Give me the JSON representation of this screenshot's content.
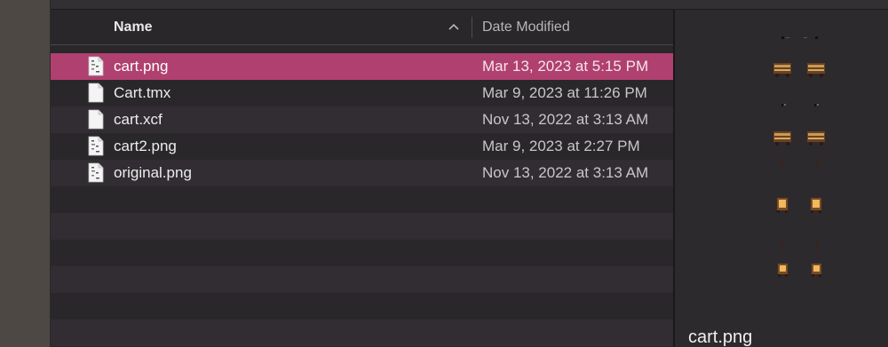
{
  "columns": {
    "name": "Name",
    "date_modified": "Date Modified"
  },
  "files": [
    {
      "name": "cart.png",
      "date": "Mar 13, 2023 at 5:15 PM",
      "icon": "image-file-icon",
      "selected": true
    },
    {
      "name": "Cart.tmx",
      "date": "Mar 9, 2023 at 11:26 PM",
      "icon": "document-file-icon",
      "selected": false
    },
    {
      "name": "cart.xcf",
      "date": "Nov 13, 2022 at 3:13 AM",
      "icon": "document-file-icon",
      "selected": false
    },
    {
      "name": "cart2.png",
      "date": "Mar 9, 2023 at 2:27 PM",
      "icon": "image-file-icon",
      "selected": false
    },
    {
      "name": "original.png",
      "date": "Nov 13, 2022 at 3:13 AM",
      "icon": "image-file-icon",
      "selected": false
    }
  ],
  "preview": {
    "filename": "cart.png"
  },
  "colors": {
    "selection": "#b0406f",
    "background": "#2a272b",
    "stripe": "#312d32"
  }
}
